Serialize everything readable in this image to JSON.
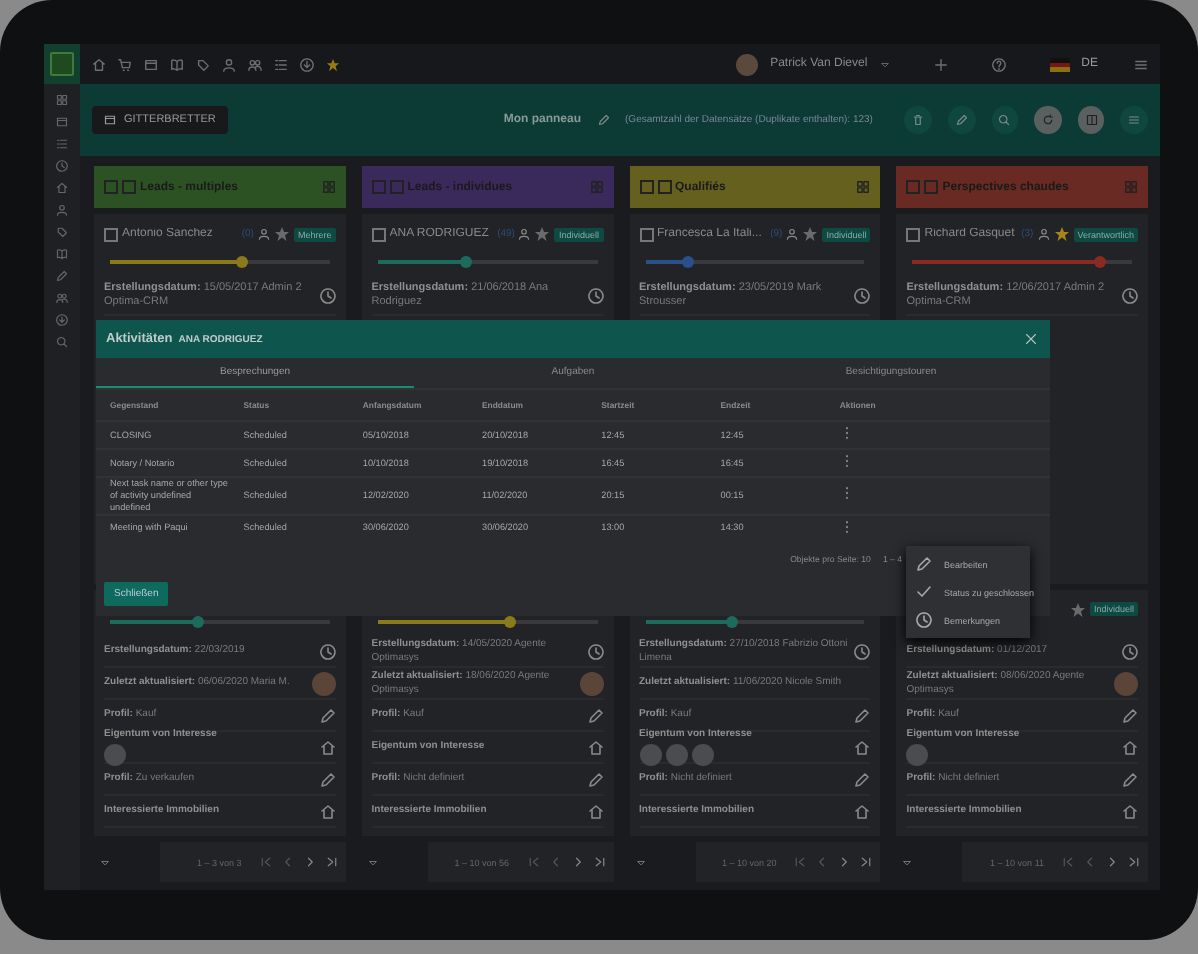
{
  "topbar": {
    "user": "Patrick Van Dievel",
    "language": "DE"
  },
  "toolbar": {
    "view_button": "GITTERBRETTER",
    "board_name": "Mon panneau",
    "record_count": "(Gesamtzahl der Datensätze (Duplikate enthalten): 123)"
  },
  "columns": [
    {
      "title": "Leads - multiples",
      "color": "#2c5224",
      "top_card": {
        "checked": false,
        "name": "Antonio Sanchez",
        "count": "(0)",
        "badge": "Mehrere",
        "starred": false,
        "level": 0.6,
        "color": "#8a7a1c",
        "created": "**Erstellungsdatum:** 15/05/2017 Admin 2 Optima-CRM"
      },
      "lower_card": {
        "level": 0.4,
        "color": "#1d6b5c",
        "rows": [
          {
            "kind": "date",
            "text": "**Erstellungsdatum:** 22/03/2019"
          },
          {
            "kind": "updated",
            "text": "**Zuletzt aktualisiert:** 06/06/2020 Maria M."
          },
          {
            "kind": "profile",
            "text": "**Profil:** Kauf"
          },
          {
            "kind": "property",
            "text": "**Eigentum von Interesse**",
            "photos": [
              {
                "kind": "photo"
              }
            ]
          },
          {
            "kind": "profile",
            "text": "**Profil:** Zu verkaufen"
          },
          {
            "kind": "property",
            "text": "**Interessierte Immobilien**"
          }
        ]
      },
      "pagination": "1 – 3 von 3"
    },
    {
      "title": "Leads - individues",
      "color": "#3a2a5c",
      "top_card": {
        "checked": false,
        "name": "ANA RODRIGUEZ",
        "count": "(49)",
        "badge": "Individuell",
        "starred": false,
        "level": 0.4,
        "color": "#1d6b5c",
        "created": "**Erstellungsdatum:** 21/06/2018 Ana Rodriguez"
      },
      "lower_card": {
        "level": 0.6,
        "color": "#8a7a1c",
        "rows": [
          {
            "kind": "date",
            "text": "**Erstellungsdatum:** 14/05/2020 Agente Optimasys"
          },
          {
            "kind": "updated",
            "text": "**Zuletzt aktualisiert:** 18/06/2020 Agente Optimasys"
          },
          {
            "kind": "profile",
            "text": "**Profil:** Kauf"
          },
          {
            "kind": "property",
            "text": "**Eigentum von Interesse**"
          },
          {
            "kind": "profile",
            "text": "**Profil:** Nicht definiert"
          },
          {
            "kind": "property",
            "text": "**Interessierte Immobilien**"
          }
        ]
      },
      "pagination": "1 – 10 von 56"
    },
    {
      "title": "Qualifiés",
      "color": "#66601f",
      "top_card": {
        "checked": false,
        "name": "Francesca La Itali...",
        "count": "(9)",
        "badge": "Individuell",
        "starred": false,
        "level": 0.2,
        "color": "#2a4f8a",
        "created": "**Erstellungsdatum:** 23/05/2019 Mark Strousser"
      },
      "lower_card": {
        "level": 0.4,
        "color": "#1d6b5c",
        "rows": [
          {
            "kind": "date",
            "text": "**Erstellungsdatum:** 27/10/2018 Fabrizio Ottoni Limena"
          },
          {
            "kind": "plain",
            "text": "**Zuletzt aktualisiert:** 11/06/2020 Nicole Smith"
          },
          {
            "kind": "profile",
            "text": "**Profil:** Kauf"
          },
          {
            "kind": "property",
            "text": "**Eigentum von Interesse**",
            "photos": [
              {
                "kind": "photo"
              },
              {
                "kind": "photo"
              },
              {
                "kind": "photo"
              }
            ]
          },
          {
            "kind": "profile",
            "text": "**Profil:** Nicht definiert"
          },
          {
            "kind": "property",
            "text": "**Interessierte Immobilien**"
          }
        ]
      },
      "pagination": "1 – 10 von 20"
    },
    {
      "title": "Perspectives chaudes",
      "color": "#682a22",
      "top_card": {
        "checked": false,
        "name": "Richard Gasquet",
        "count": "(3)",
        "badge": "Verantwortlich",
        "starred": true,
        "level": 0.85,
        "color": "#8a2a22",
        "created": "**Erstellungsdatum:** 12/06/2017 Admin 2 Optima-CRM"
      },
      "lower_card": {
        "starred": false,
        "badge": "Individuell",
        "rows": [
          {
            "kind": "date",
            "text": "**Erstellungsdatum:** 01/12/2017"
          },
          {
            "kind": "updated",
            "text": "**Zuletzt aktualisiert:** 08/06/2020 Agente Optimasys"
          },
          {
            "kind": "profile",
            "text": "**Profil:** Kauf"
          },
          {
            "kind": "property",
            "text": "**Eigentum von Interesse**",
            "photos": [
              {
                "kind": "photo"
              }
            ]
          },
          {
            "kind": "profile",
            "text": "**Profil:** Nicht definiert"
          },
          {
            "kind": "property",
            "text": "**Interessierte Immobilien**"
          }
        ]
      },
      "pagination": "1 – 10 von 11"
    }
  ],
  "dialog": {
    "title": "Aktivitäten",
    "subtitle": "ANA RODRIGUEZ",
    "tabs": [
      {
        "label": "Besprechungen",
        "selected": true
      },
      {
        "label": "Aufgaben",
        "selected": false
      },
      {
        "label": "Besichtigungstouren",
        "selected": false
      }
    ],
    "table": {
      "columns": [
        "Gegenstand",
        "Status",
        "Anfangsdatum",
        "Enddatum",
        "Startzeit",
        "Endzeit",
        "Aktionen"
      ],
      "rows": [
        [
          "CLOSING",
          "Scheduled",
          "05/10/2018",
          "20/10/2018",
          "12:45",
          "12:45"
        ],
        [
          "Notary / Notario",
          "Scheduled",
          "10/10/2018",
          "19/10/2018",
          "16:45",
          "16:45"
        ],
        [
          "Next task name or other type of activity undefined undefined",
          "Scheduled",
          "12/02/2020",
          "11/02/2020",
          "20:15",
          "00:15"
        ],
        [
          "Meeting with Paqui",
          "Scheduled",
          "30/06/2020",
          "30/06/2020",
          "13:00",
          "14:30"
        ]
      ]
    },
    "per_page": "Objekte pro Seite: 10",
    "range": "1 – 4",
    "close_button": "Schließen"
  },
  "context_menu": [
    {
      "kind": "edit",
      "label": "Bearbeiten"
    },
    {
      "kind": "check",
      "label": "Status zu geschlossen"
    },
    {
      "kind": "clock",
      "label": "Bemerkungen"
    }
  ]
}
